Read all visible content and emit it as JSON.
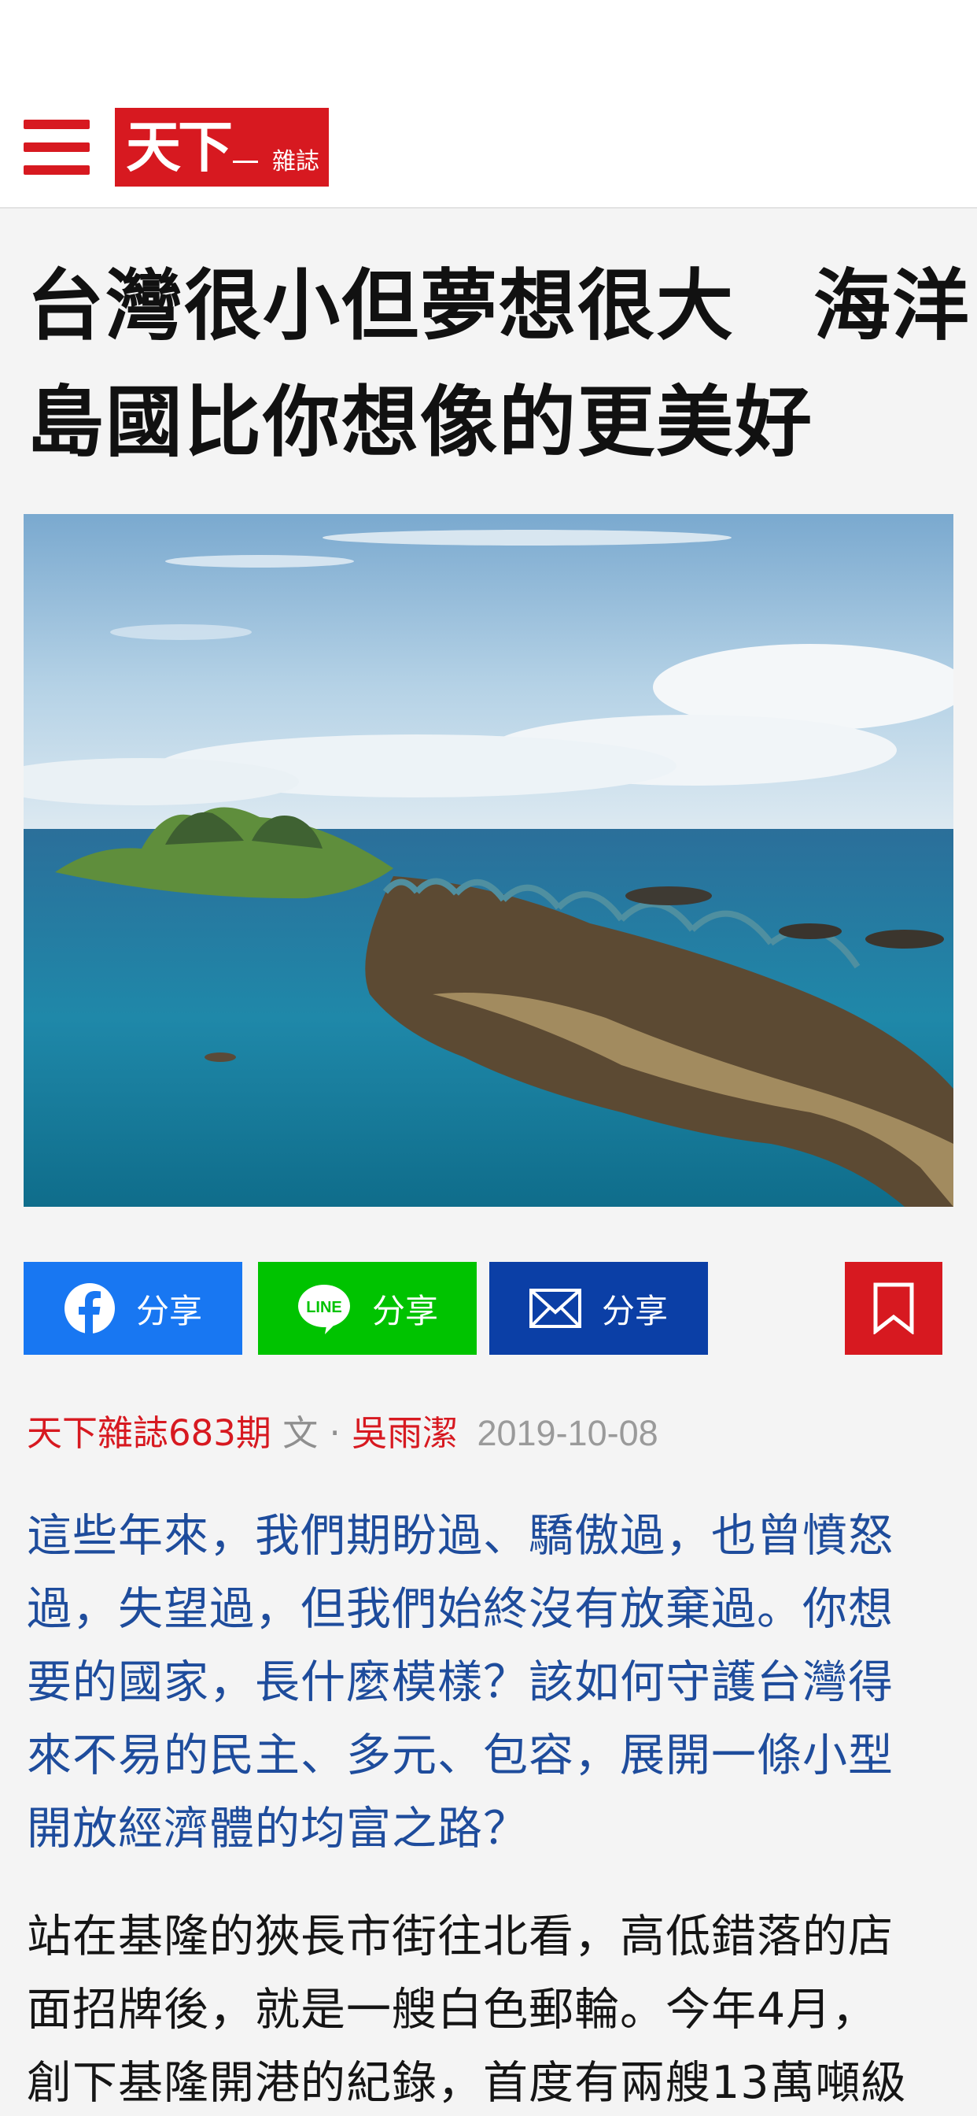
{
  "header": {
    "logo_main": "天下",
    "logo_sub": "雜誌",
    "menu_icon": "hamburger-menu-icon"
  },
  "article": {
    "title_lines": [
      "台灣很小但夢想很大　海洋",
      "島國比你想像的更美好"
    ],
    "hero_image": "coastal-islet-with-arched-bridge",
    "share_buttons": {
      "facebook_label": "分享",
      "line_label": "分享",
      "line_logo_text": "LINE",
      "mail_label": "分享"
    },
    "bookmark_icon": "bookmark-icon",
    "meta": {
      "source": "天下雜誌683期",
      "byline_prefix": "文 · ",
      "author": "吳雨潔",
      "date": "2019-10-08"
    },
    "lead_lines": [
      "這些年來，我們期盼過、驕傲過，也曾憤怒",
      "過，失望過，但我們始終沒有放棄過。你想",
      "要的國家，長什麼模樣？該如何守護台灣得",
      "來不易的民主、多元、包容，展開一條小型",
      "開放經濟體的均富之路？"
    ],
    "body_lines": [
      "站在基隆的狹長市街往北看，高低錯落的店",
      "面招牌後，就是一艘白色郵輪。今年4月，",
      "創下基隆開港的紀錄，首度有兩艘13萬噸級"
    ]
  },
  "colors": {
    "brand_red": "#d71920",
    "facebook_blue": "#1877f2",
    "line_green": "#00c300",
    "mail_blue": "#0b3fa6",
    "lead_blue": "#1e4c9c"
  }
}
